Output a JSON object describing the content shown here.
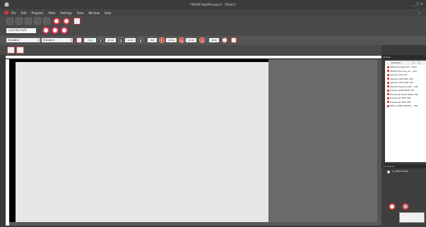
{
  "window": {
    "title": "PRO5N PageManager5 - [Plate1]",
    "controls": "_  □  ×"
  },
  "menu": {
    "items": [
      "File",
      "Edit",
      "Program",
      "Plate",
      "Settings",
      "View",
      "Window",
      "Help"
    ],
    "mdi_controls": "_ ×"
  },
  "toolbar2": {
    "zoom_value": "1_ZOOM_PLATE"
  },
  "toolbar3": {
    "media_combo": "Standard",
    "quality_combo": "Standard",
    "copies": "1,00",
    "p_value": "20,00",
    "q_value": "10,00",
    "r_value": "300",
    "s_value": "20,00",
    "t_value": "10,00",
    "u_value": "1000",
    "letters": [
      "P",
      "Q",
      "R",
      "P",
      "Q",
      "Q"
    ]
  },
  "sidebar": {
    "title": "Ablage",
    "columns": [
      "Jobname",
      "A...",
      "S..."
    ],
    "jobs": [
      {
        "name": "Pfeilwerbung/Schrif...",
        "size": "1000"
      },
      {
        "name": "SF200_Ahm-One_Lin...",
        "size": "120"
      },
      {
        "name": "element_test",
        "size": "100"
      },
      {
        "name": "element_test 0001",
        "size": "100"
      },
      {
        "name": "element_test 0002",
        "size": "100"
      },
      {
        "name": "Test_Flimmerbild_A50...",
        "size": "100"
      },
      {
        "name": "ProLase Lights NOW",
        "size": "100"
      },
      {
        "name": "ProLase 60 white Waste",
        "size": "100"
      },
      {
        "name": "ProLase 50 TEST",
        "size": "900"
      },
      {
        "name": "ProLase 20 TEST",
        "size": "300"
      },
      {
        "name": "Elfden_1000_C260Pro...",
        "size": "250"
      }
    ]
  },
  "jobqueue": {
    "title": "Job Queue",
    "item": "0_JobPreview"
  },
  "colors": {
    "accent": "#cc2222",
    "dark_bg": "#3a3a3a",
    "page": "#e7e7e7"
  }
}
